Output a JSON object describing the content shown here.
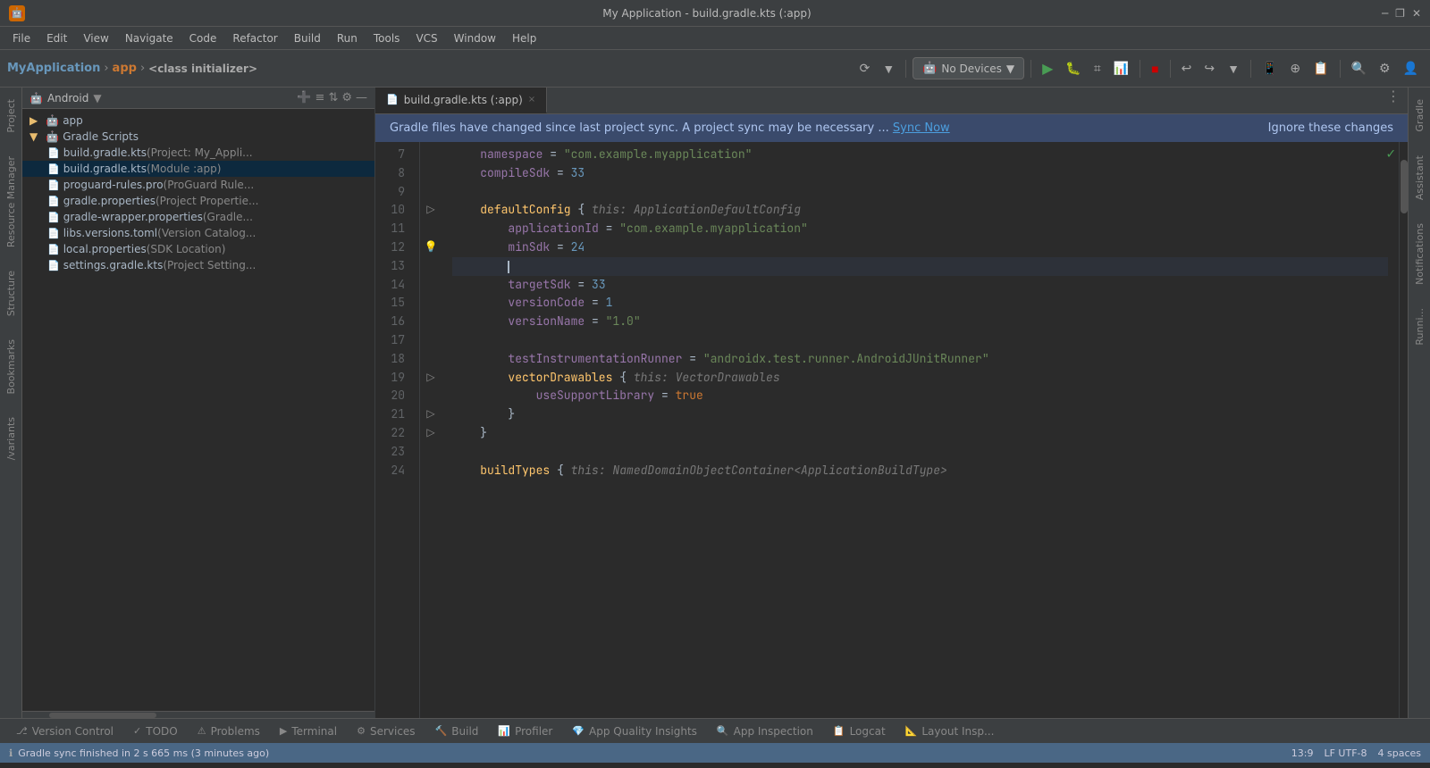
{
  "titlebar": {
    "icon": "🤖",
    "title": "My Application - build.gradle.kts (:app)",
    "minimize": "─",
    "restore": "❐",
    "close": "✕"
  },
  "menubar": {
    "items": [
      "File",
      "Edit",
      "View",
      "Navigate",
      "Code",
      "Refactor",
      "Build",
      "Run",
      "Tools",
      "VCS",
      "Window",
      "Help"
    ]
  },
  "toolbar": {
    "project": "MyApplication",
    "sep1": "›",
    "module": "app",
    "sep2": "›",
    "class": "<class initializer>",
    "device_icon": "🤖",
    "device_label": "No Devices"
  },
  "tab": {
    "label": "build.gradle.kts (:app)",
    "close": "×",
    "menu_icon": "⋮"
  },
  "sync_banner": {
    "text": "Gradle files have changed since last project sync. A project sync may be necessary ...",
    "sync_link": "Sync Now",
    "ignore_link": "Ignore these changes"
  },
  "filetree": {
    "title": "Android",
    "items": [
      {
        "indent": 0,
        "icon": "▶",
        "label": "app",
        "sublabel": "",
        "type": "folder",
        "selected": false
      },
      {
        "indent": 0,
        "icon": "▼",
        "label": "Gradle Scripts",
        "sublabel": "",
        "type": "folder",
        "selected": false
      },
      {
        "indent": 1,
        "icon": "📄",
        "label": "build.gradle.kts",
        "sublabel": " (Project: My_Appli...",
        "type": "file",
        "selected": false
      },
      {
        "indent": 1,
        "icon": "📄",
        "label": "build.gradle.kts",
        "sublabel": " (Module :app)",
        "type": "file",
        "selected": true
      },
      {
        "indent": 1,
        "icon": "📄",
        "label": "proguard-rules.pro",
        "sublabel": " (ProGuard Rule...",
        "type": "file",
        "selected": false
      },
      {
        "indent": 1,
        "icon": "📄",
        "label": "gradle.properties",
        "sublabel": " (Project Propertie...",
        "type": "file",
        "selected": false
      },
      {
        "indent": 1,
        "icon": "📄",
        "label": "gradle-wrapper.properties",
        "sublabel": " (Gradle...",
        "type": "file",
        "selected": false
      },
      {
        "indent": 1,
        "icon": "📄",
        "label": "libs.versions.toml",
        "sublabel": " (Version Catalog...",
        "type": "file",
        "selected": false
      },
      {
        "indent": 1,
        "icon": "📄",
        "label": "local.properties",
        "sublabel": " (SDK Location)",
        "type": "file",
        "selected": false
      },
      {
        "indent": 1,
        "icon": "📄",
        "label": "settings.gradle.kts",
        "sublabel": " (Project Setting...",
        "type": "file",
        "selected": false
      }
    ]
  },
  "code": {
    "lines": [
      {
        "num": 7,
        "gutter": "",
        "content": "namespace = \"com.example.myapplication\""
      },
      {
        "num": 8,
        "gutter": "",
        "content": "compileSdk = 33"
      },
      {
        "num": 9,
        "gutter": "",
        "content": ""
      },
      {
        "num": 10,
        "gutter": "▷",
        "content": "defaultConfig { this: ApplicationDefaultConfig"
      },
      {
        "num": 11,
        "gutter": "",
        "content": "    applicationId = \"com.example.myapplication\""
      },
      {
        "num": 12,
        "gutter": "💡",
        "content": "    minSdk = 24"
      },
      {
        "num": 13,
        "gutter": "",
        "content": ""
      },
      {
        "num": 14,
        "gutter": "",
        "content": "    targetSdk = 33"
      },
      {
        "num": 15,
        "gutter": "",
        "content": "    versionCode = 1"
      },
      {
        "num": 16,
        "gutter": "",
        "content": "    versionName = \"1.0\""
      },
      {
        "num": 17,
        "gutter": "",
        "content": ""
      },
      {
        "num": 18,
        "gutter": "",
        "content": "    testInstrumentationRunner = \"androidx.test.runner.AndroidJUnitRunner\""
      },
      {
        "num": 19,
        "gutter": "▷",
        "content": "    vectorDrawables { this: VectorDrawables"
      },
      {
        "num": 20,
        "gutter": "",
        "content": "        useSupportLibrary = true"
      },
      {
        "num": 21,
        "gutter": "▷",
        "content": "    }"
      },
      {
        "num": 22,
        "gutter": "▷",
        "content": "}"
      },
      {
        "num": 23,
        "gutter": "",
        "content": ""
      },
      {
        "num": 24,
        "gutter": "",
        "content": "buildTypes { this: NamedDomainObjectContainer<ApplicationBuildType>"
      }
    ]
  },
  "bottom_tabs": [
    {
      "icon": "⎇",
      "label": "Version Control"
    },
    {
      "icon": "✓",
      "label": "TODO"
    },
    {
      "icon": "⚠",
      "label": "Problems"
    },
    {
      "icon": "▶",
      "label": "Terminal"
    },
    {
      "icon": "⚙",
      "label": "Services"
    },
    {
      "icon": "🔨",
      "label": "Build"
    },
    {
      "icon": "📊",
      "label": "Profiler"
    },
    {
      "icon": "💎",
      "label": "App Quality Insights"
    },
    {
      "icon": "🔍",
      "label": "App Inspection"
    },
    {
      "icon": "📋",
      "label": "Logcat"
    },
    {
      "icon": "📐",
      "label": "Layout Insp..."
    }
  ],
  "statusbar": {
    "left_icon": "ℹ",
    "message": "Gradle sync finished in 2 s 665 ms (3 minutes ago)",
    "cursor_pos": "13:9",
    "encoding": "LF   UTF-8",
    "indent": "4 spaces"
  },
  "right_panels": [
    "Gradle",
    "Assistant",
    "Notifications",
    "Running"
  ]
}
